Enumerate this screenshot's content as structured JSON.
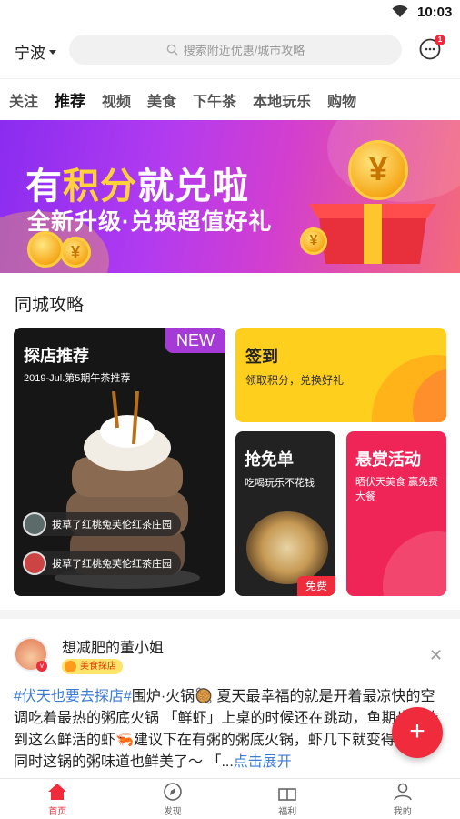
{
  "status_bar": {
    "time": "10:03",
    "wifi_icon": "wifi-icon"
  },
  "header": {
    "city": "宁波",
    "search_placeholder": "搜索附近优惠/城市攻略",
    "message_badge": "1"
  },
  "tabs": [
    {
      "label": "关注",
      "active": false
    },
    {
      "label": "推荐",
      "active": true
    },
    {
      "label": "视频",
      "active": false
    },
    {
      "label": "美食",
      "active": false
    },
    {
      "label": "下午茶",
      "active": false
    },
    {
      "label": "本地玩乐",
      "active": false
    },
    {
      "label": "购物",
      "active": false
    }
  ],
  "banner": {
    "title_prefix": "有",
    "title_highlight": "积分",
    "title_suffix": "就兑啦",
    "subtitle": "全新升级·兑换超值好礼",
    "coin_symbol": "¥",
    "dot_count": 3,
    "active_dot": 0
  },
  "guide": {
    "section_title": "同城攻略",
    "tandian": {
      "title": "探店推荐",
      "badge": "NEW",
      "desc": "2019-Jul.第5期午茶推荐",
      "feed": [
        "拔草了红桃兔芙伦红茶庄园",
        "拔草了红桃兔芙伦红茶庄园"
      ]
    },
    "qiandao": {
      "title": "签到",
      "desc": "领取积分，兑换好礼"
    },
    "free": {
      "title": "抢免单",
      "desc": "吃喝玩乐不花钱",
      "badge": "免费"
    },
    "reward": {
      "title": "悬赏活动",
      "desc": "晒伏天美食 赢免费大餐"
    }
  },
  "post": {
    "author": "想减肥的董小姐",
    "tag": "美食探店",
    "verified_mark": "v",
    "hashtag": "#伏天也要去探店#",
    "text": "围炉·火锅🥘 夏天最幸福的就是开着最凉快的空调吃着最热的粥底火锅 「鲜虾」上桌的时候还在跳动，鱼期也能吃到这么鲜活的虾🦐建议下在有粥的粥底火锅，虾几下就变得通红，同时这锅的粥味道也鲜美了～ 「...",
    "more": "点击展开",
    "close_symbol": "✕"
  },
  "fab": {
    "symbol": "+"
  },
  "bottom_nav": [
    {
      "label": "首页",
      "icon": "home-icon",
      "active": true
    },
    {
      "label": "发现",
      "icon": "compass-icon",
      "active": false
    },
    {
      "label": "福利",
      "icon": "gift-icon",
      "active": false
    },
    {
      "label": "我的",
      "icon": "profile-icon",
      "active": false
    }
  ],
  "colors": {
    "accent": "#ef2b3c",
    "link": "#3d7bd6",
    "yellow": "#ffcf1e",
    "pink": "#ef2558",
    "purple": "#a63ad6"
  }
}
